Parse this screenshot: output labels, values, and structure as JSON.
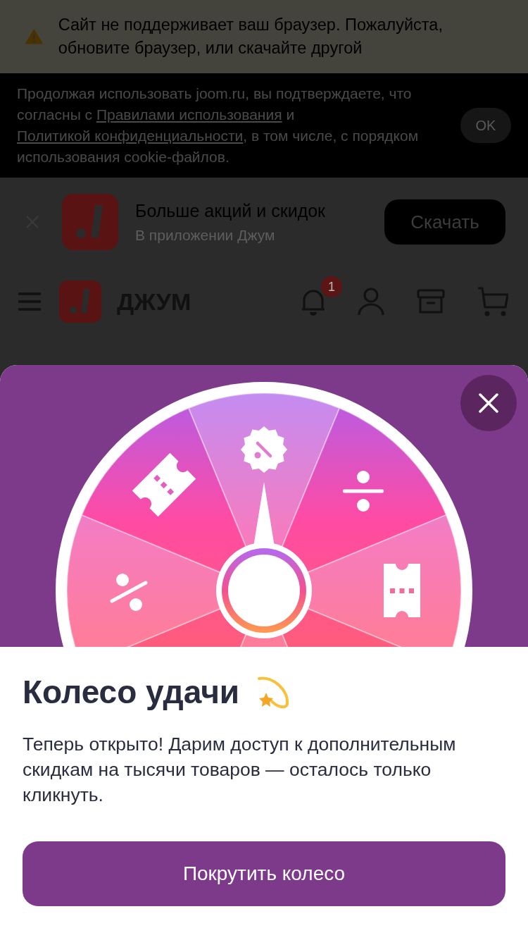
{
  "browser_warning": {
    "text": "Сайт не поддерживает ваш браузер. Пожалуйста, обновите браузер, или скачайте другой"
  },
  "cookie_notice": {
    "segments": [
      {
        "kind": "text",
        "text": "Продолжая использовать joom.ru, вы подтверждаете, что согласны с "
      },
      {
        "kind": "link",
        "text": "Правилами использования"
      },
      {
        "kind": "text",
        "text": " и "
      },
      {
        "kind": "link",
        "text": "Политикой конфиденциальности"
      },
      {
        "kind": "text",
        "text": ", в том числе, с порядком использования cookie-файлов."
      }
    ],
    "button": "OK"
  },
  "app_banner": {
    "title": "Больше акций и скидок",
    "subtitle": "В приложении Джум",
    "button": "Скачать"
  },
  "header": {
    "logo_text": "ДЖУМ",
    "notification_count": "1"
  },
  "wheel_modal": {
    "title": "Колесо удачи",
    "description": "Теперь открыто! Дарим доступ к дополнительным скидкам на тысячи товаров — осталось только кликнуть.",
    "button": "Покрутить колесо"
  }
}
